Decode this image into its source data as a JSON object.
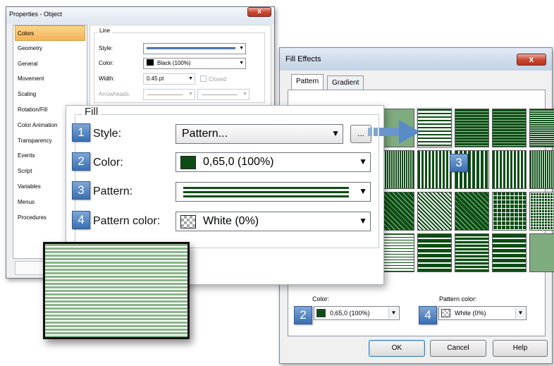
{
  "properties_window": {
    "title": "Properties - Object",
    "close_label": "x",
    "categories": [
      {
        "label": "Colors",
        "selected": true
      },
      {
        "label": "Geometry"
      },
      {
        "label": "General"
      },
      {
        "label": "Movement"
      },
      {
        "label": "Scaling"
      },
      {
        "label": "Rotation/Fill"
      },
      {
        "label": "Color Animation"
      },
      {
        "label": "Transparency"
      },
      {
        "label": "Events"
      },
      {
        "label": "Script"
      },
      {
        "label": "Variables"
      },
      {
        "label": "Menus"
      },
      {
        "label": "Procedures"
      }
    ],
    "line_group": {
      "title": "Line",
      "style_label": "Style:",
      "color_label": "Color:",
      "color_value": "Black (100%)",
      "width_label": "Width:",
      "width_value": "0.45 pt",
      "closed_label": "Closed",
      "arrowheads_label": "Arrowheads:"
    }
  },
  "fill_zoom": {
    "group_title": "Fill",
    "rows": [
      {
        "badge": "1",
        "label": "Style:",
        "value": "Pattern...",
        "more_label": "..."
      },
      {
        "badge": "2",
        "label": "Color:",
        "value": "0,65,0 (100%)",
        "swatch": "#0c4d14"
      },
      {
        "badge": "3",
        "label": "Pattern:",
        "value": ""
      },
      {
        "badge": "4",
        "label": "Pattern color:",
        "value": "White (0%)"
      }
    ]
  },
  "fill_effects": {
    "title": "Fill Effects",
    "close_label": "x",
    "tabs": [
      {
        "label": "Pattern",
        "active": true
      },
      {
        "label": "Gradient"
      }
    ],
    "grid_badge": "3",
    "color_label": "Color:",
    "color_value": "0,65,0 (100%)",
    "color_badge": "2",
    "pattern_color_label": "Pattern color:",
    "pattern_color_value": "White (0%)",
    "pattern_color_badge": "4",
    "buttons": {
      "ok": "OK",
      "cancel": "Cancel",
      "help": "Help"
    }
  },
  "colors": {
    "pattern_green": "#0c4d14",
    "callout_blue": "#3a6fb1",
    "selected_orange": "#f2b35a"
  }
}
